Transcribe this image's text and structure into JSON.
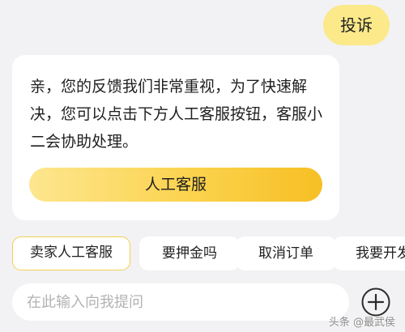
{
  "chat": {
    "user_message": "投诉",
    "bot_message": "亲，您的反馈我们非常重视，为了快速解决，您可以点击下方人工客服按钮，客服小二会协助处理。",
    "agent_button_label": "人工客服"
  },
  "quick_replies": [
    {
      "label": "卖家人工客服"
    },
    {
      "label": "要押金吗"
    },
    {
      "label": "取消订单"
    },
    {
      "label": "我要开发"
    }
  ],
  "input": {
    "placeholder": "在此输入向我提问",
    "value": ""
  },
  "icons": {
    "plus": "plus-circle-icon"
  },
  "watermark": "头条 @最武侯",
  "colors": {
    "accent_yellow": "#fbd34e",
    "user_bubble": "#fbe98a",
    "chip_active_border": "#f3cf4f",
    "background": "#f2f2f4"
  }
}
